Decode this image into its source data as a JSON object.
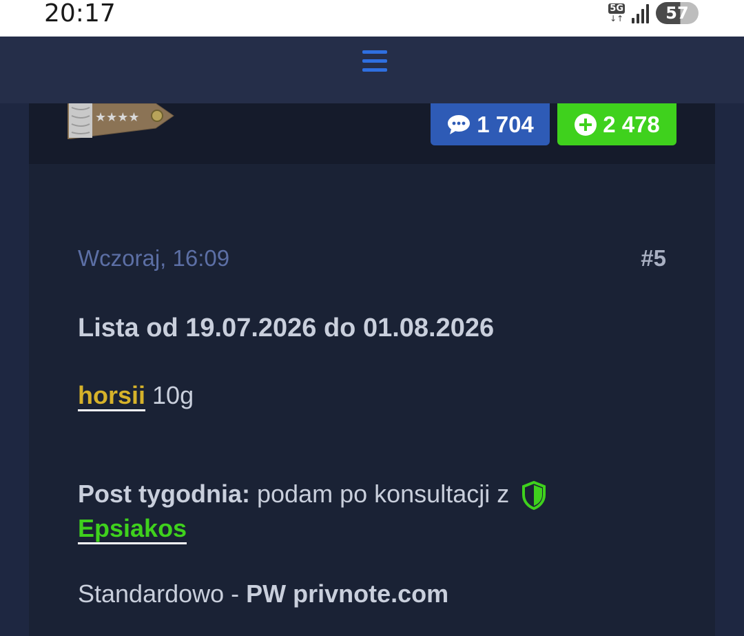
{
  "status_bar": {
    "time": "20:17",
    "network": "5G",
    "network_arrows": "↓↑",
    "battery": "57"
  },
  "nav": {
    "menu_icon": "hamburger-menu-icon"
  },
  "profile": {
    "rank_badge_stars": "★★★★",
    "comments_count": "1 704",
    "comments_icon": "speech-bubble-icon",
    "reputation_count": "2 478",
    "reputation_icon": "plus-circle-icon"
  },
  "post": {
    "date": "Wczoraj, 16:09",
    "number": "#5",
    "heading": "Lista od 19.07.2026 do 01.08.2026",
    "entry_user": "horsii",
    "entry_value": "10g",
    "post_of_week_label": "Post tygodnia:",
    "post_of_week_text": "podam po konsultacji z",
    "shield_icon": "shield-icon",
    "moderator_user": "Epsiakos",
    "standard_text": "Standardowo - ",
    "standard_bold": "PW privnote.com"
  },
  "colors": {
    "background": "#1b2236",
    "nav": "#252e49",
    "comments_button": "#2e5bb6",
    "reputation_button": "#3fd11d",
    "gold_user": "#d6b22a",
    "green_user": "#3fd11d",
    "date_text": "#5c6fa5"
  }
}
